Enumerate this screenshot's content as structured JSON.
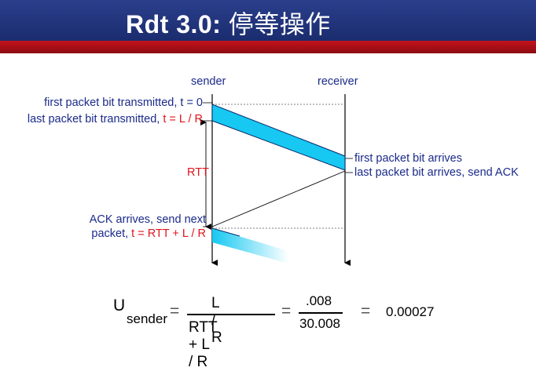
{
  "title": {
    "main": "Rdt 3.0:",
    "cn": "停等操作"
  },
  "diagram": {
    "sender_label": "sender",
    "receiver_label": "receiver",
    "left_labels": {
      "first_sent": "first packet bit transmitted, t = 0",
      "last_sent_prefix": "last packet bit transmitted, ",
      "last_sent_eq": "t = L / R",
      "rtt": "RTT",
      "ack_line1": "ACK arrives, send next",
      "ack_line2_prefix": "packet, ",
      "ack_line2_eq": "t = RTT + L / R"
    },
    "right_labels": {
      "first_arrives": "first packet bit arrives",
      "last_arrives": "last packet bit arrives, send ACK"
    },
    "colors": {
      "packet": "#16c8f2",
      "packet_stroke": "#0a2a6a",
      "text_blue": "#1a2a8a",
      "text_red": "#e0141c"
    }
  },
  "formula": {
    "u": "U",
    "subscript": "sender",
    "eq1": "=",
    "numerator": "L / R",
    "denominator": "RTT + L / R",
    "eq2": "=",
    "num2": ".008",
    "den2": "30.008",
    "eq3": "=",
    "result": "0.00027"
  }
}
